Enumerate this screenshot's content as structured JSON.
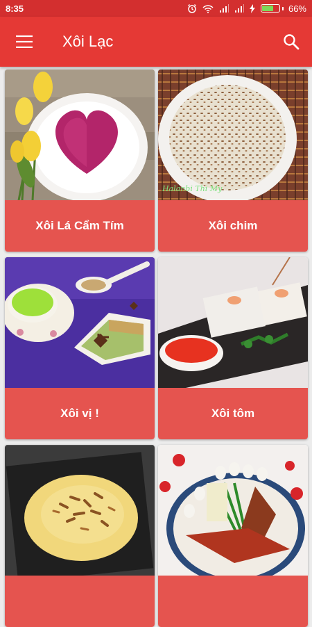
{
  "status": {
    "time": "8:35",
    "battery": "66%",
    "battery_level": 0.66
  },
  "appbar": {
    "title": "Xôi Lạc",
    "menu_icon": "hamburger-menu-icon",
    "search_icon": "search-icon"
  },
  "cards": [
    {
      "label": "Xôi Lá Cẩm Tím"
    },
    {
      "label": "Xôi chim",
      "watermark": "Halanbi Thi My"
    },
    {
      "label": "Xôi vị !"
    },
    {
      "label": "Xôi tôm"
    },
    {
      "label": ""
    },
    {
      "label": ""
    }
  ],
  "colors": {
    "statusbar": "#d32f2f",
    "appbar": "#e53935",
    "card_label": "#e5544f"
  }
}
